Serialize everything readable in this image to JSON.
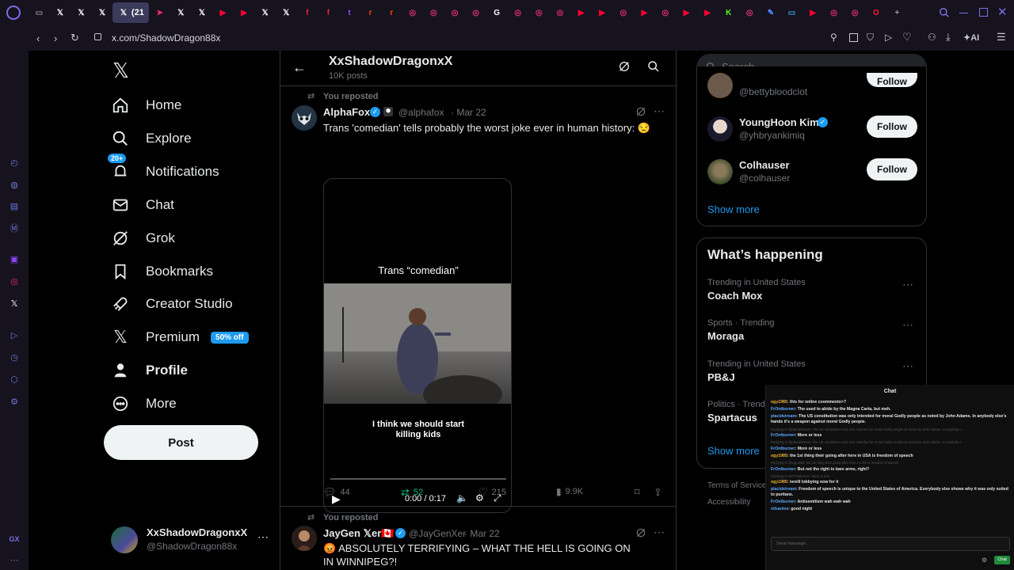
{
  "browser": {
    "active_tab_label": "(21",
    "url": "x.com/ShadowDragon88x",
    "ai_label": "AI",
    "gx_label": "GX",
    "tabs": [
      {
        "icon": "window-icon",
        "color": "#8a8a9a",
        "glyph": "▭"
      },
      {
        "icon": "x-icon",
        "color": "#ffffff",
        "glyph": "𝕏"
      },
      {
        "icon": "x-icon",
        "color": "#ffffff",
        "glyph": "𝕏"
      },
      {
        "icon": "x-icon",
        "color": "#ffffff",
        "glyph": "𝕏"
      },
      {
        "icon": "x-icon-active",
        "color": "#ffffff",
        "glyph": "𝕏"
      },
      {
        "icon": "flag-icon",
        "color": "#ff3366",
        "glyph": "➤"
      },
      {
        "icon": "x-icon",
        "color": "#ffffff",
        "glyph": "𝕏"
      },
      {
        "icon": "x-icon",
        "color": "#ffffff",
        "glyph": "𝕏"
      },
      {
        "icon": "youtube-icon",
        "color": "#ff0033",
        "glyph": "▶"
      },
      {
        "icon": "youtube-icon",
        "color": "#ff0033",
        "glyph": "▶"
      },
      {
        "icon": "x-icon",
        "color": "#ffffff",
        "glyph": "𝕏"
      },
      {
        "icon": "x-icon",
        "color": "#ffffff",
        "glyph": "𝕏"
      },
      {
        "icon": "flipboard-icon",
        "color": "#e12828",
        "glyph": "f"
      },
      {
        "icon": "flipboard-icon",
        "color": "#e12828",
        "glyph": "f"
      },
      {
        "icon": "twitch-icon",
        "color": "#9146ff",
        "glyph": "t"
      },
      {
        "icon": "reddit-icon",
        "color": "#ff4500",
        "glyph": "r"
      },
      {
        "icon": "reddit-icon",
        "color": "#ff4500",
        "glyph": "r"
      },
      {
        "icon": "instagram-icon",
        "color": "#e1306c",
        "glyph": "◎"
      },
      {
        "icon": "instagram-icon",
        "color": "#e1306c",
        "glyph": "◎"
      },
      {
        "icon": "instagram-icon",
        "color": "#e1306c",
        "glyph": "◎"
      },
      {
        "icon": "instagram-icon",
        "color": "#e1306c",
        "glyph": "◎"
      },
      {
        "icon": "google-icon",
        "color": "#ffffff",
        "glyph": "G"
      },
      {
        "icon": "instagram-icon",
        "color": "#e1306c",
        "glyph": "◎"
      },
      {
        "icon": "instagram-icon",
        "color": "#e1306c",
        "glyph": "◎"
      },
      {
        "icon": "instagram-icon",
        "color": "#e1306c",
        "glyph": "◎"
      },
      {
        "icon": "youtube-icon",
        "color": "#ff0033",
        "glyph": "▶"
      },
      {
        "icon": "youtube-icon",
        "color": "#ff0033",
        "glyph": "▶"
      },
      {
        "icon": "instagram-icon",
        "color": "#e1306c",
        "glyph": "◎"
      },
      {
        "icon": "youtube-icon",
        "color": "#ff0033",
        "glyph": "▶"
      },
      {
        "icon": "instagram-icon",
        "color": "#e1306c",
        "glyph": "◎"
      },
      {
        "icon": "youtube-icon",
        "color": "#ff0033",
        "glyph": "▶"
      },
      {
        "icon": "youtube-icon",
        "color": "#ff0033",
        "glyph": "▶"
      },
      {
        "icon": "kick-icon",
        "color": "#53fc18",
        "glyph": "K"
      },
      {
        "icon": "instagram-icon",
        "color": "#e1306c",
        "glyph": "◎"
      },
      {
        "icon": "edit-icon",
        "color": "#4a8cff",
        "glyph": "✎"
      },
      {
        "icon": "window-icon",
        "color": "#3aa0e8",
        "glyph": "▭"
      },
      {
        "icon": "youtube-icon",
        "color": "#ff0033",
        "glyph": "▶"
      },
      {
        "icon": "instagram-icon",
        "color": "#e1306c",
        "glyph": "◎"
      },
      {
        "icon": "instagram-icon",
        "color": "#e1306c",
        "glyph": "◎"
      },
      {
        "icon": "opera-icon",
        "color": "#ff1b2d",
        "glyph": "O"
      },
      {
        "icon": "plus-icon",
        "color": "#9a9aaa",
        "glyph": "+"
      }
    ]
  },
  "nav": {
    "items": [
      {
        "id": "home",
        "label": "Home",
        "icon": "home-icon"
      },
      {
        "id": "explore",
        "label": "Explore",
        "icon": "search-icon"
      },
      {
        "id": "notifications",
        "label": "Notifications",
        "icon": "bell-icon",
        "badge": "20+"
      },
      {
        "id": "chat",
        "label": "Chat",
        "icon": "mail-icon"
      },
      {
        "id": "grok",
        "label": "Grok",
        "icon": "grok-icon"
      },
      {
        "id": "bookmarks",
        "label": "Bookmarks",
        "icon": "bookmark-icon"
      },
      {
        "id": "creator-studio",
        "label": "Creator Studio",
        "icon": "rocket-icon"
      },
      {
        "id": "premium",
        "label": "Premium",
        "icon": "x-logo-icon",
        "badge": "50% off"
      },
      {
        "id": "profile",
        "label": "Profile",
        "icon": "person-icon"
      },
      {
        "id": "more",
        "label": "More",
        "icon": "more-circle-icon"
      }
    ],
    "post_label": "Post",
    "account": {
      "name": "XxShadowDragonxX",
      "handle": "@ShadowDragon88x"
    }
  },
  "profile_header": {
    "name": "XxShadowDragonxX",
    "posts": "10K posts"
  },
  "tweets": [
    {
      "repost_label": "You reposted",
      "name": "AlphaFox",
      "handle": "@alphafox",
      "date": "· Mar 22",
      "text": "Trans 'comedian' tells probably the worst joke ever in human history: 😒",
      "video": {
        "caption_top": "Trans “comedian”",
        "caption_bottom": "I think we should start killing kids",
        "time": "0:00 / 0:17"
      },
      "replies": "44",
      "reposts": "52",
      "likes": "215",
      "views": "9.9K"
    },
    {
      "repost_label": "You reposted",
      "name": "JayGen 𝕏er🇨🇦",
      "handle": "@JayGenXer",
      "date": "· Mar 22",
      "text": "😡 ABSOLUTELY TERRIFYING – WHAT THE HELL IS GOING ON IN WINNIPEG?!"
    }
  ],
  "right": {
    "search_placeholder": "Search",
    "who_to_follow": [
      {
        "name": "",
        "handle": "@bettybloodclot",
        "button": "Follow"
      },
      {
        "name": "YoungHoon Kim",
        "handle": "@yhbryankimiq",
        "button": "Follow",
        "verified": true
      },
      {
        "name": "Colhauser",
        "handle": "@colhauser",
        "button": "Follow"
      }
    ],
    "show_more": "Show more",
    "happening_title": "What’s happening",
    "trends": [
      {
        "context": "Trending in United States",
        "name": "Coach Mox"
      },
      {
        "context": "Sports · Trending",
        "name": "Moraga"
      },
      {
        "context": "Trending in United States",
        "name": "PB&J"
      },
      {
        "context": "Politics · Trend",
        "name": "Spartacus"
      }
    ],
    "show_more_2": "Show more",
    "footer": [
      "Terms of Service",
      "Accessibility"
    ]
  },
  "chat_overlay": {
    "title": "Chat",
    "messages": [
      {
        "user": "ogy1985",
        "text": ": this for online coomments>?"
      },
      {
        "user": "FrOntburner",
        "text": ": The used to abide by the Magna Carta, but meh."
      },
      {
        "user": "placidstream",
        "text": ": The US constitution was only intended for moral Godly people as noted by John Adams. In anybody else's hands it's a weapon against moral Godly people."
      },
      {
        "reply": "Replying to @placidstream: The US constitution was only intended for moral Godly people as noted by John Adams. In anybody e..."
      },
      {
        "user": "FrOntburner",
        "text": ": More or less"
      },
      {
        "reply": "Replying to @placidstream: The US constitution was only intended for moral Godly people as noted by John Adams. In anybody e..."
      },
      {
        "user": "FrOntburner",
        "text": ": More or less"
      },
      {
        "user": "ogy1985",
        "text": ": the 1st thing their going after here in USA is freedom of speech"
      },
      {
        "reply": "Replying to @ogy1985: the 1st thing their going after here in USA is freedom of speech"
      },
      {
        "user": "FrOntburner",
        "text": ": But not the right to bare arms, right?"
      },
      {
        "reply": "Replying to @FrOntburner: More or less"
      },
      {
        "user": "ogy1985",
        "text": ": isreili lobbying now for it"
      },
      {
        "user": "placidstream",
        "text": ": Freedom of speech is unique to the United States of America. Everybody else shows why it was only suited to puritans."
      },
      {
        "user": "FrOntburner",
        "text": ": Antisemitism wah wah wah"
      },
      {
        "user": "nilsanise",
        "text": ": good night"
      }
    ],
    "input_placeholder": "Send message...",
    "send_label": "Chat"
  }
}
